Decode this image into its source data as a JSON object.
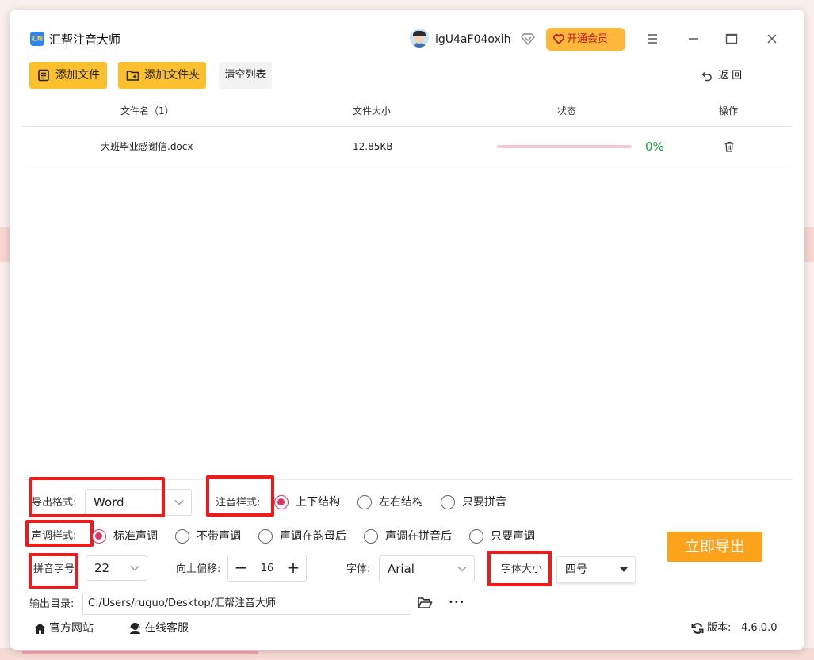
{
  "app": {
    "title": "汇帮注音大师",
    "logo_text": "汇帮"
  },
  "user": {
    "name": "igU4aF04oxih",
    "vip_button": "开通会员"
  },
  "toolbar": {
    "add_file": "添加文件",
    "add_folder": "添加文件夹",
    "clear_list": "清空列表",
    "back": "返 回"
  },
  "table": {
    "columns": [
      "文件名（1）",
      "文件大小",
      "状态",
      "操作"
    ],
    "rows": [
      {
        "name": "大班毕业感谢信.docx",
        "size": "12.85KB",
        "progress": 0,
        "progress_text": "0%"
      }
    ]
  },
  "settings": {
    "export_format": {
      "label": "导出格式:",
      "value": "Word"
    },
    "annotation_style": {
      "label": "注音样式:",
      "options": [
        "上下结构",
        "左右结构",
        "只要拼音"
      ],
      "selected": 0
    },
    "tone_style": {
      "label": "声调样式:",
      "options": [
        "标准声调",
        "不带声调",
        "声调在韵母后",
        "声调在拼音后",
        "只要声调"
      ],
      "selected": 0
    },
    "pinyin_size": {
      "label": "拼音字号",
      "value": "22"
    },
    "offset": {
      "label": "向上偏移:",
      "value": "16",
      "minus": "−",
      "plus": "+"
    },
    "font": {
      "label": "字体:",
      "value": "Arial"
    },
    "font_size": {
      "label": "字体大小",
      "value": "四号"
    },
    "export_button": "立即导出",
    "output_dir": {
      "label": "输出目录:",
      "value": "C:/Users/ruguo/Desktop/汇帮注音大师",
      "more": "•••"
    }
  },
  "footer": {
    "website": "官方网站",
    "support": "在线客服",
    "version_label": "版本:",
    "version": "4.6.0.0"
  },
  "colors": {
    "accent_yellow": "#fcc02e",
    "export_orange": "#fca31b",
    "radio_selected": "#e8315f",
    "progress_green": "#19a93b",
    "highlight_red": "#ee1b1b"
  }
}
